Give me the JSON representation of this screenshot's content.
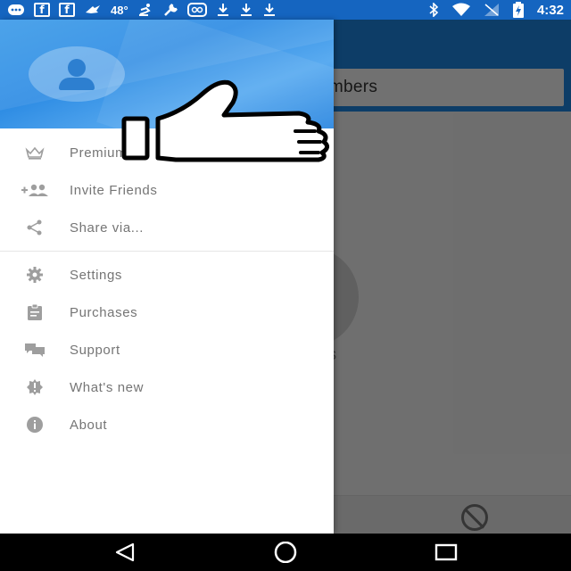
{
  "status_bar": {
    "temperature": "48°",
    "time": "4:32",
    "icons": [
      "messages-icon",
      "facebook-icon",
      "facebook-icon",
      "plane-icon",
      "weather-icon",
      "skater-icon",
      "wrench-icon",
      "voicemail-icon",
      "download-icon",
      "download-icon",
      "download-icon",
      "bluetooth-icon",
      "wifi-icon",
      "no-signal-icon",
      "battery-charging-icon"
    ]
  },
  "background_app": {
    "search_text": "umbers",
    "partial_text": "s"
  },
  "drawer": {
    "items_group1": [
      {
        "label": "Premium",
        "icon": "crown-icon"
      },
      {
        "label": "Invite Friends",
        "icon": "add-people-icon"
      },
      {
        "label": "Share via...",
        "icon": "share-icon"
      }
    ],
    "items_group2": [
      {
        "label": "Settings",
        "icon": "gear-icon"
      },
      {
        "label": "Purchases",
        "icon": "clipboard-icon"
      },
      {
        "label": "Support",
        "icon": "chat-bubbles-icon"
      },
      {
        "label": "What's new",
        "icon": "new-badge-icon"
      },
      {
        "label": "About",
        "icon": "info-icon"
      }
    ]
  },
  "colors": {
    "status_bar": "#1565c0",
    "drawer_header": "#3d9be9",
    "menu_text": "#757575",
    "menu_icon": "#9e9e9e"
  },
  "overlay": {
    "icon": "thumbs-up-icon"
  },
  "navigation": {
    "buttons": [
      "back-icon",
      "home-icon",
      "recents-icon"
    ]
  }
}
